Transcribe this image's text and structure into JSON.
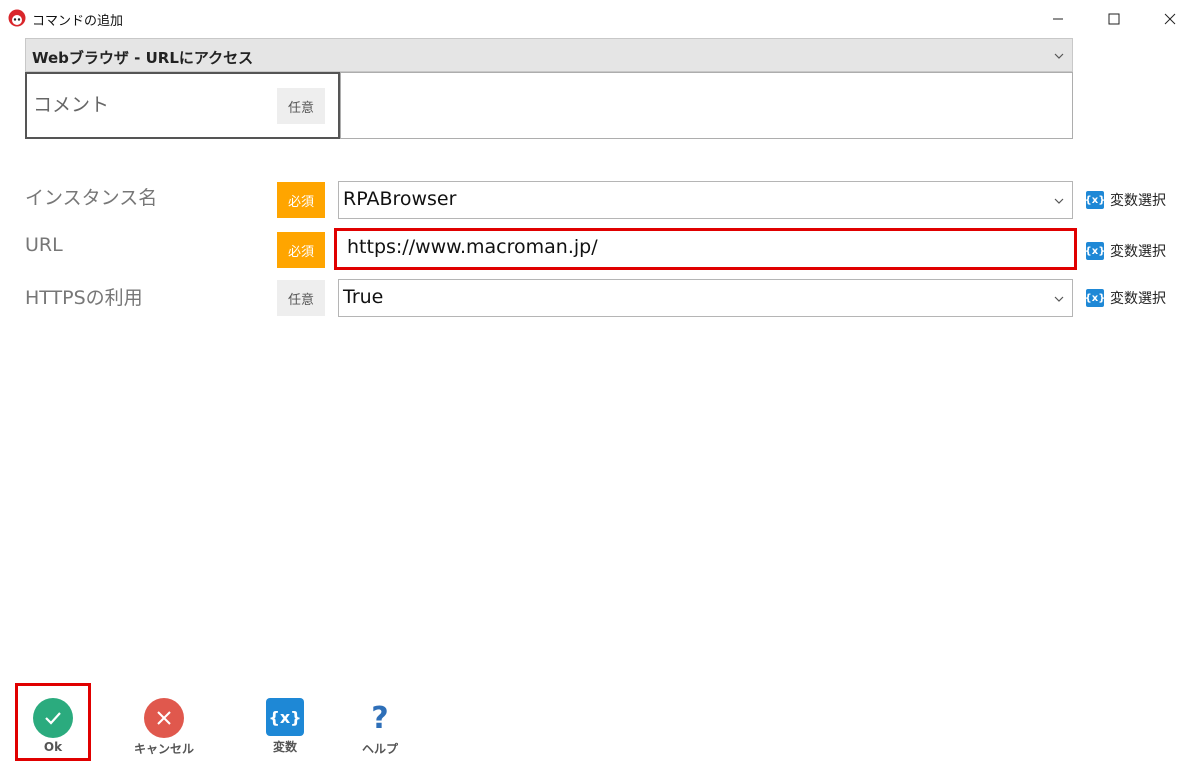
{
  "window": {
    "title": "コマンドの追加",
    "icon": "macroman-app-icon",
    "controls": [
      "minimize-icon",
      "maximize-icon",
      "close-icon"
    ]
  },
  "command": {
    "selected": "Webブラウザ - URLにアクセス"
  },
  "comment": {
    "label": "コメント",
    "badge": "任意",
    "value": ""
  },
  "fields": [
    {
      "label": "インスタンス名",
      "badge": "必須",
      "value": "RPABrowser",
      "var_button": "変数選択",
      "control": "dropdown"
    },
    {
      "label": "URL",
      "badge": "必須",
      "value": "https://www.macroman.jp/",
      "var_button": "変数選択",
      "control": "textbox",
      "highlighted": true
    },
    {
      "label": "HTTPSの利用",
      "badge": "任意",
      "value": "True",
      "var_button": "変数選択",
      "control": "dropdown"
    }
  ],
  "var_icon_text": "{x}",
  "toolbar": {
    "ok_label": "Ok",
    "cancel_label": "キャンセル",
    "variable_label": "変数",
    "variable_icon_text": "{x}",
    "help_label": "ヘルプ",
    "help_icon_text": "?"
  },
  "colors": {
    "required_badge": "#ffa500",
    "optional_badge": "#eeeeee",
    "highlight": "#e00000",
    "ok_green": "#2bab7e",
    "cancel_red": "#e0584d",
    "variable_blue": "#1e88d6",
    "help_blue": "#2e6fb8"
  }
}
